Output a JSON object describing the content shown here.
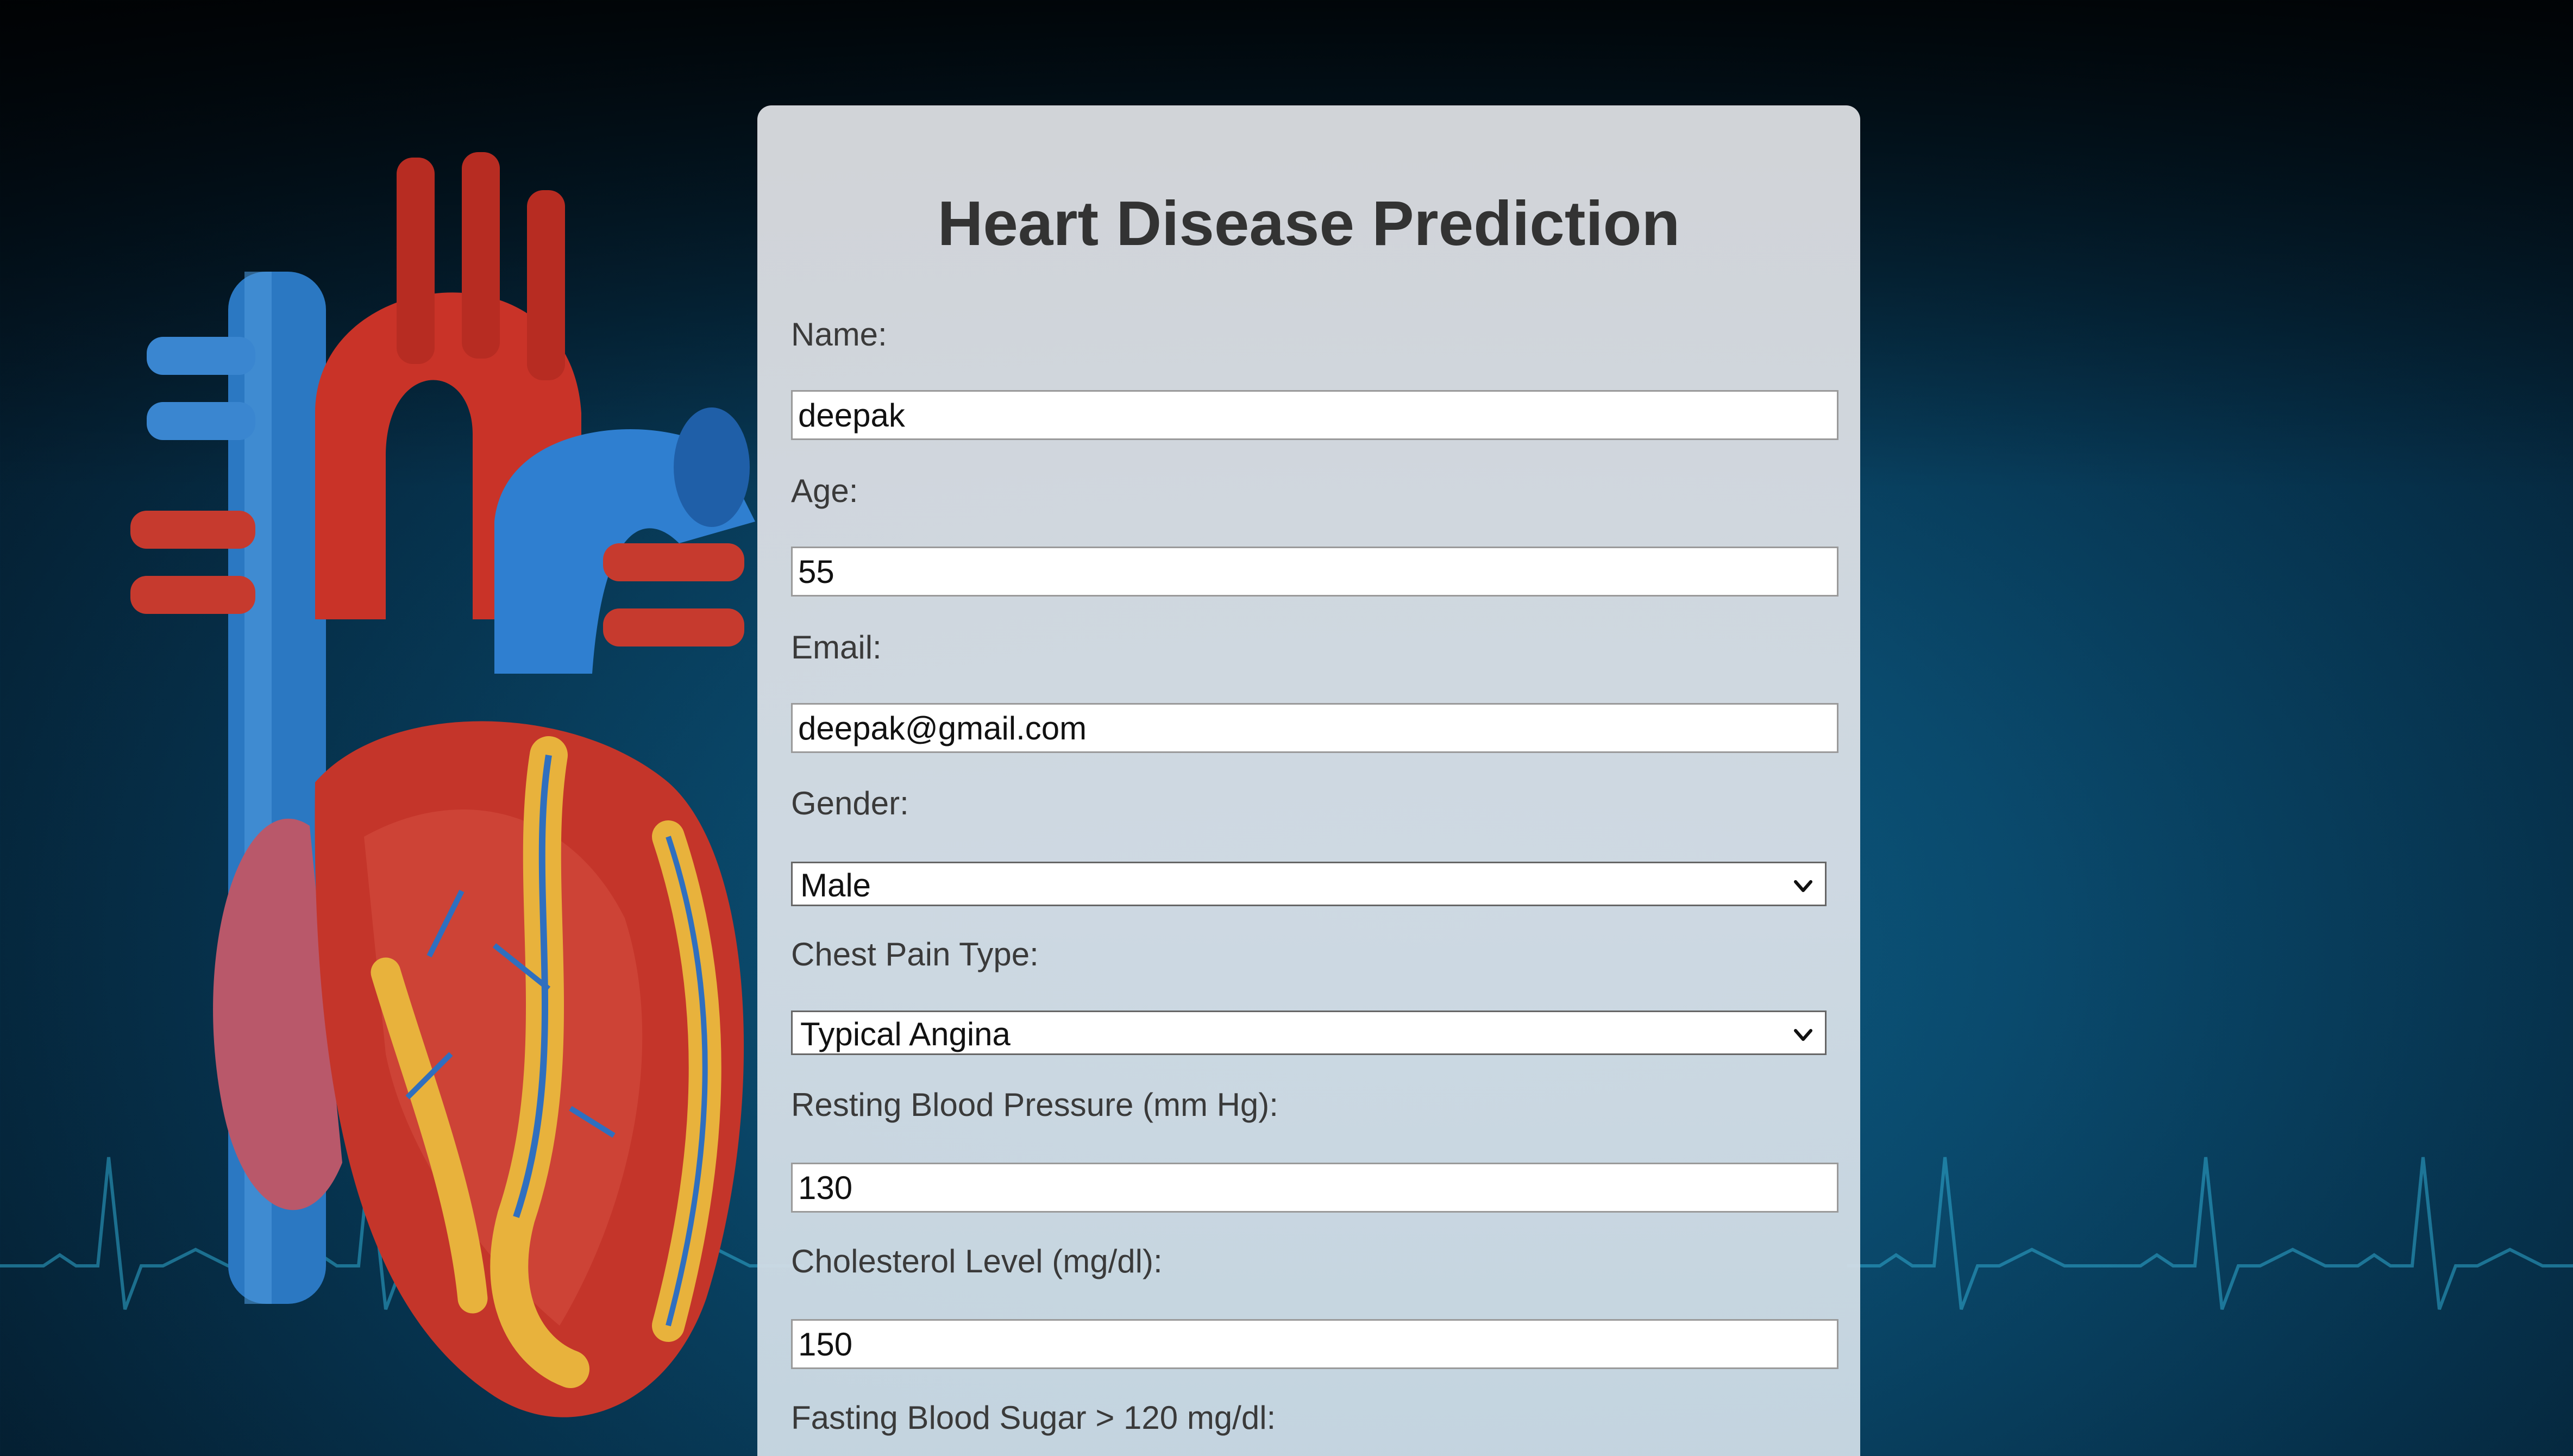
{
  "form": {
    "title": "Heart Disease Prediction",
    "fields": {
      "name": {
        "label": "Name:",
        "value": "deepak"
      },
      "age": {
        "label": "Age:",
        "value": "55"
      },
      "email": {
        "label": "Email:",
        "value": "deepak@gmail.com"
      },
      "gender": {
        "label": "Gender:",
        "selected": "Male"
      },
      "chest_pain": {
        "label": "Chest Pain Type:",
        "selected": "Typical Angina"
      },
      "resting_bp": {
        "label": "Resting Blood Pressure (mm Hg):",
        "value": "130"
      },
      "cholesterol": {
        "label": "Cholesterol Level (mg/dl):",
        "value": "150"
      },
      "fasting_sugar": {
        "label": "Fasting Blood Sugar > 120 mg/dl:"
      }
    }
  },
  "colors": {
    "background": "#0a4a6d",
    "card": "#d6dce2",
    "title": "#333333",
    "label": "#3a3a3a"
  },
  "icons": {
    "select_arrow": "chevron-down-icon",
    "illustration": "anatomical-heart-illustration"
  }
}
